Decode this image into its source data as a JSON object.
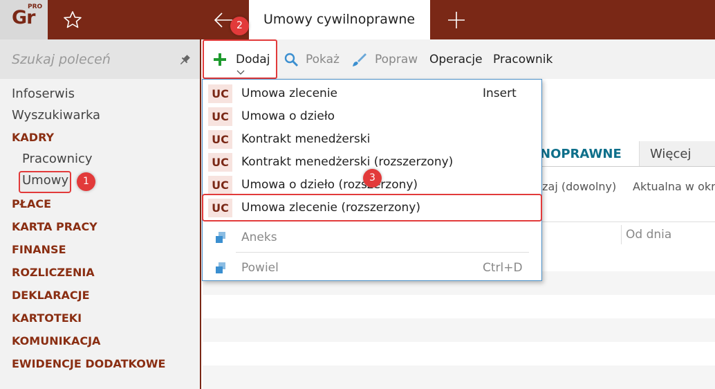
{
  "app": {
    "logo_text": "Gr",
    "logo_badge": "PRO",
    "active_tab_title": "Umowy cywilnoprawne"
  },
  "sidebar": {
    "search_placeholder": "Szukaj poleceń",
    "items": [
      {
        "label": "Infoserwis",
        "kind": "link"
      },
      {
        "label": "Wyszukiwarka",
        "kind": "link"
      },
      {
        "label": "KADRY",
        "kind": "section"
      },
      {
        "label": "Pracownicy",
        "kind": "sub"
      },
      {
        "label": "Umowy",
        "kind": "sub",
        "selected": true
      },
      {
        "label": "PŁACE",
        "kind": "section"
      },
      {
        "label": "KARTA PRACY",
        "kind": "section"
      },
      {
        "label": "FINANSE",
        "kind": "section"
      },
      {
        "label": "ROZLICZENIA",
        "kind": "section"
      },
      {
        "label": "DEKLARACJE",
        "kind": "section"
      },
      {
        "label": "KARTOTEKI",
        "kind": "section"
      },
      {
        "label": "KOMUNIKACJA",
        "kind": "section"
      },
      {
        "label": "EWIDENCJE DODATKOWE",
        "kind": "section"
      }
    ]
  },
  "toolbar": {
    "dodaj": "Dodaj",
    "pokaz": "Pokaż",
    "popraw": "Popraw",
    "operacje": "Operacje",
    "pracownik": "Pracownik"
  },
  "main": {
    "tab_active_partial": "NOPRAWNE",
    "tab_more": "Więcej",
    "filter_1": "dzaj (dowolny)",
    "filter_2": "Aktualna w okr",
    "column_od_dnia": "Od dnia"
  },
  "dropdown": {
    "items": [
      {
        "badge": "UC",
        "label": "Umowa zlecenie",
        "shortcut": "Insert"
      },
      {
        "badge": "UC",
        "label": "Umowa o dzieło",
        "shortcut": ""
      },
      {
        "badge": "UC",
        "label": "Kontrakt menedżerski",
        "shortcut": ""
      },
      {
        "badge": "UC",
        "label": "Kontrakt menedżerski (rozszerzony)",
        "shortcut": ""
      },
      {
        "badge": "UC",
        "label": "Umowa o dzieło (rozszerzony)",
        "shortcut": ""
      },
      {
        "badge": "UC",
        "label": "Umowa zlecenie (rozszerzony)",
        "shortcut": "",
        "highlighted": true
      },
      {
        "icon": "copy-icon",
        "label": "Aneks",
        "shortcut": "",
        "disabled": true
      },
      {
        "icon": "copy-icon",
        "label": "Powiel",
        "shortcut": "Ctrl+D",
        "disabled": true
      }
    ]
  },
  "markers": [
    "1",
    "2",
    "3"
  ],
  "colors": {
    "brand": "#7a2816",
    "accent_blue": "#0e6f8a",
    "marker_red": "#e23a3a",
    "add_green": "#1e9a2e"
  }
}
